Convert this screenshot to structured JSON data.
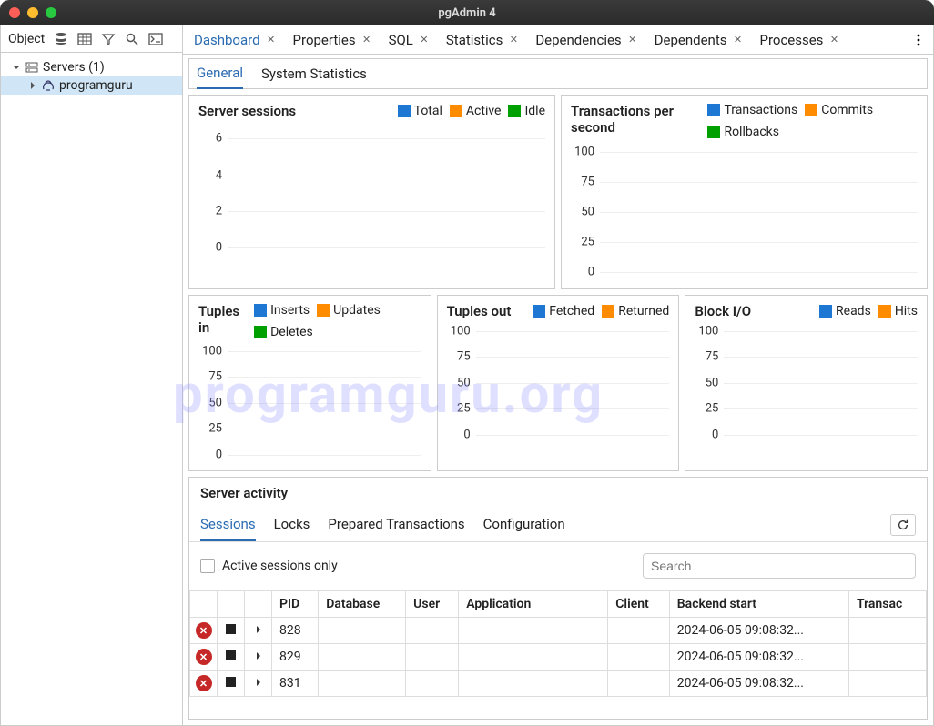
{
  "window": {
    "title": "pgAdmin 4"
  },
  "sidebar": {
    "label": "Object",
    "items": [
      {
        "label": "Servers (1)"
      },
      {
        "label": "programguru"
      }
    ]
  },
  "tabs": [
    {
      "label": "Dashboard",
      "active": true
    },
    {
      "label": "Properties"
    },
    {
      "label": "SQL"
    },
    {
      "label": "Statistics"
    },
    {
      "label": "Dependencies"
    },
    {
      "label": "Dependents"
    },
    {
      "label": "Processes"
    }
  ],
  "subtabs": [
    {
      "label": "General",
      "active": true
    },
    {
      "label": "System Statistics"
    }
  ],
  "charts": {
    "sessions": {
      "title": "Server sessions",
      "legend": [
        {
          "label": "Total",
          "color": "blue"
        },
        {
          "label": "Active",
          "color": "orange"
        },
        {
          "label": "Idle",
          "color": "green"
        }
      ],
      "yticks": [
        "6",
        "4",
        "2",
        "0"
      ]
    },
    "tps": {
      "title": "Transactions per second",
      "legend": [
        {
          "label": "Transactions",
          "color": "blue"
        },
        {
          "label": "Commits",
          "color": "orange"
        },
        {
          "label": "Rollbacks",
          "color": "green"
        }
      ],
      "yticks": [
        "100",
        "75",
        "50",
        "25",
        "0"
      ]
    },
    "tin": {
      "title": "Tuples in",
      "legend": [
        {
          "label": "Inserts",
          "color": "blue"
        },
        {
          "label": "Updates",
          "color": "orange"
        },
        {
          "label": "Deletes",
          "color": "green"
        }
      ],
      "yticks": [
        "100",
        "75",
        "50",
        "25",
        "0"
      ]
    },
    "tout": {
      "title": "Tuples out",
      "legend": [
        {
          "label": "Fetched",
          "color": "blue"
        },
        {
          "label": "Returned",
          "color": "orange"
        }
      ],
      "yticks": [
        "100",
        "75",
        "50",
        "25",
        "0"
      ]
    },
    "bio": {
      "title": "Block I/O",
      "legend": [
        {
          "label": "Reads",
          "color": "blue"
        },
        {
          "label": "Hits",
          "color": "orange"
        }
      ],
      "yticks": [
        "100",
        "75",
        "50",
        "25",
        "0"
      ]
    }
  },
  "activity": {
    "title": "Server activity",
    "tabs": [
      {
        "label": "Sessions",
        "active": true
      },
      {
        "label": "Locks"
      },
      {
        "label": "Prepared Transactions"
      },
      {
        "label": "Configuration"
      }
    ],
    "filter_label": "Active sessions only",
    "search_placeholder": "Search",
    "columns": [
      "",
      "",
      "",
      "PID",
      "Database",
      "User",
      "Application",
      "Client",
      "Backend start",
      "Transac"
    ],
    "rows": [
      {
        "pid": "828",
        "backend_start": "2024-06-05 09:08:32..."
      },
      {
        "pid": "829",
        "backend_start": "2024-06-05 09:08:32..."
      },
      {
        "pid": "831",
        "backend_start": "2024-06-05 09:08:32..."
      }
    ]
  },
  "watermark": "programguru.org",
  "chart_data": [
    {
      "type": "line",
      "title": "Server sessions",
      "series": [
        {
          "name": "Total",
          "values": []
        },
        {
          "name": "Active",
          "values": []
        },
        {
          "name": "Idle",
          "values": []
        }
      ],
      "ylim": [
        0,
        6
      ]
    },
    {
      "type": "line",
      "title": "Transactions per second",
      "series": [
        {
          "name": "Transactions",
          "values": []
        },
        {
          "name": "Commits",
          "values": []
        },
        {
          "name": "Rollbacks",
          "values": []
        }
      ],
      "ylim": [
        0,
        100
      ]
    },
    {
      "type": "line",
      "title": "Tuples in",
      "series": [
        {
          "name": "Inserts",
          "values": []
        },
        {
          "name": "Updates",
          "values": []
        },
        {
          "name": "Deletes",
          "values": []
        }
      ],
      "ylim": [
        0,
        100
      ]
    },
    {
      "type": "line",
      "title": "Tuples out",
      "series": [
        {
          "name": "Fetched",
          "values": []
        },
        {
          "name": "Returned",
          "values": []
        }
      ],
      "ylim": [
        0,
        100
      ]
    },
    {
      "type": "line",
      "title": "Block I/O",
      "series": [
        {
          "name": "Reads",
          "values": []
        },
        {
          "name": "Hits",
          "values": []
        }
      ],
      "ylim": [
        0,
        100
      ]
    }
  ]
}
